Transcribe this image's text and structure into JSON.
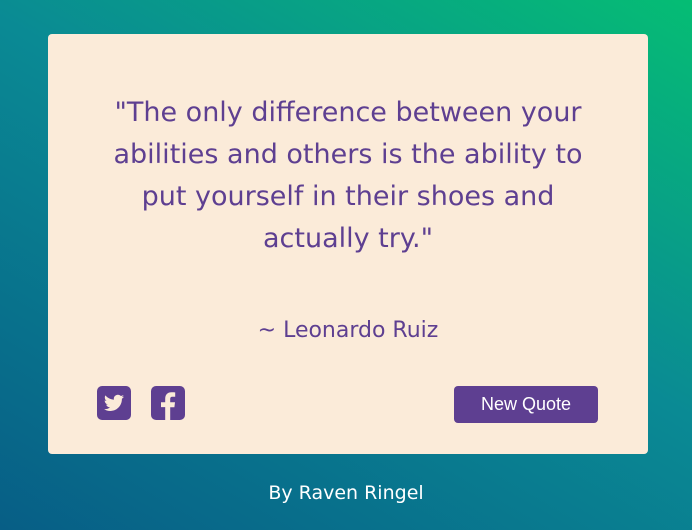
{
  "card": {
    "quote_text": "\"The only difference between your abilities and others is the ability to put yourself in their shoes and actually try.\"",
    "author": "~ Leonardo Ruiz",
    "actions": {
      "twitter_icon": "twitter-icon",
      "facebook_icon": "facebook-icon",
      "new_quote_label": "New Quote"
    }
  },
  "footer": {
    "byline": "By Raven Ringel"
  },
  "colors": {
    "accent": "#5e3f91",
    "card_background": "#fbebd9",
    "gradient_start": "#075e86",
    "gradient_end": "#05bd74"
  }
}
